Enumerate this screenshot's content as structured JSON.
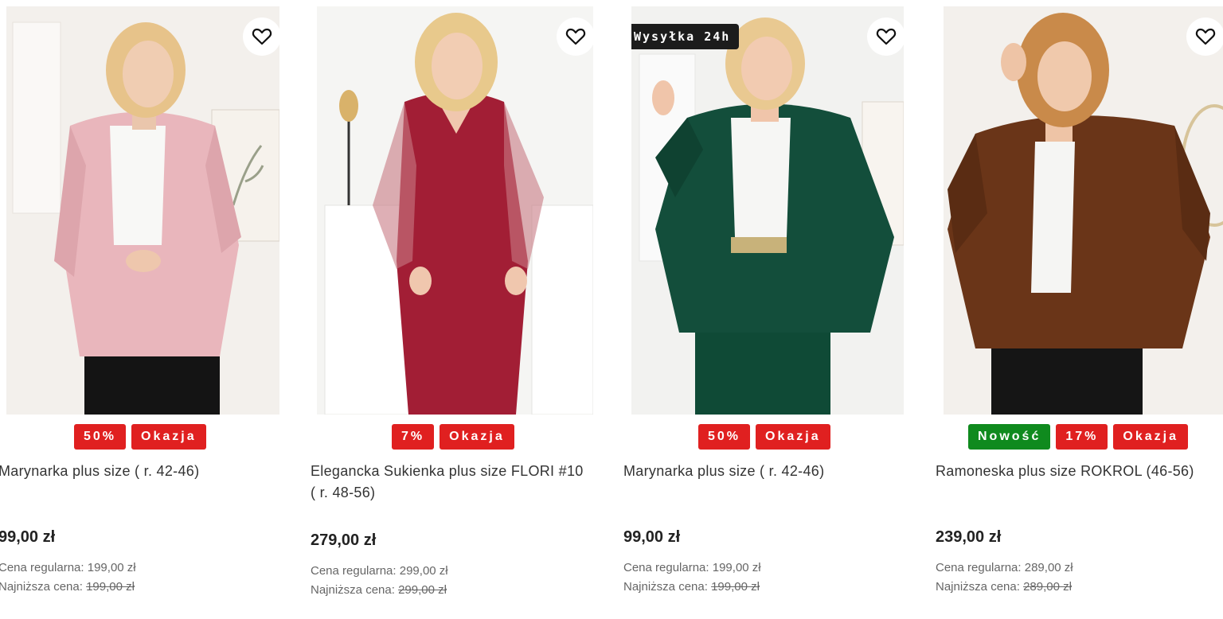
{
  "colors": {
    "badge_red": "#e02020",
    "badge_green": "#0f8a1e",
    "shipping_badge_bg": "#1c1c1c"
  },
  "products": [
    {
      "badges": [
        {
          "label": "50%",
          "color": "#e02020"
        },
        {
          "label": "Okazja",
          "color": "#e02020"
        }
      ],
      "title": "Marynarka plus size ( r. 42-46)",
      "price": "99,00 zł",
      "regular_label": "Cena regularna:",
      "regular_value": "199,00 zł",
      "lowest_label": "Najniższa cena:",
      "lowest_value": "199,00 zł",
      "favorite_icon": "heart-icon",
      "image": "woman-pink-blazer"
    },
    {
      "badges": [
        {
          "label": "7%",
          "color": "#e02020"
        },
        {
          "label": "Okazja",
          "color": "#e02020"
        }
      ],
      "title": "Elegancka Sukienka plus size FLORI #10 ( r. 48-56)",
      "price": "279,00 zł",
      "regular_label": "Cena regularna:",
      "regular_value": "299,00 zł",
      "lowest_label": "Najniższa cena:",
      "lowest_value": "299,00 zł",
      "favorite_icon": "heart-icon",
      "image": "woman-burgundy-dress"
    },
    {
      "shipping_badge": "Wysyłka 24h",
      "badges": [
        {
          "label": "50%",
          "color": "#e02020"
        },
        {
          "label": "Okazja",
          "color": "#e02020"
        }
      ],
      "title": "Marynarka plus size ( r. 42-46)",
      "price": "99,00 zł",
      "regular_label": "Cena regularna:",
      "regular_value": "199,00 zł",
      "lowest_label": "Najniższa cena:",
      "lowest_value": "199,00 zł",
      "favorite_icon": "heart-icon",
      "image": "woman-green-blazer"
    },
    {
      "badges": [
        {
          "label": "Nowość",
          "color": "#0f8a1e"
        },
        {
          "label": "17%",
          "color": "#e02020"
        },
        {
          "label": "Okazja",
          "color": "#e02020"
        }
      ],
      "title": "Ramoneska plus size ROKROL (46-56)",
      "price": "239,00 zł",
      "regular_label": "Cena regularna:",
      "regular_value": "289,00 zł",
      "lowest_label": "Najniższa cena:",
      "lowest_value": "289,00 zł",
      "favorite_icon": "heart-icon",
      "image": "woman-brown-leather-jacket"
    }
  ]
}
